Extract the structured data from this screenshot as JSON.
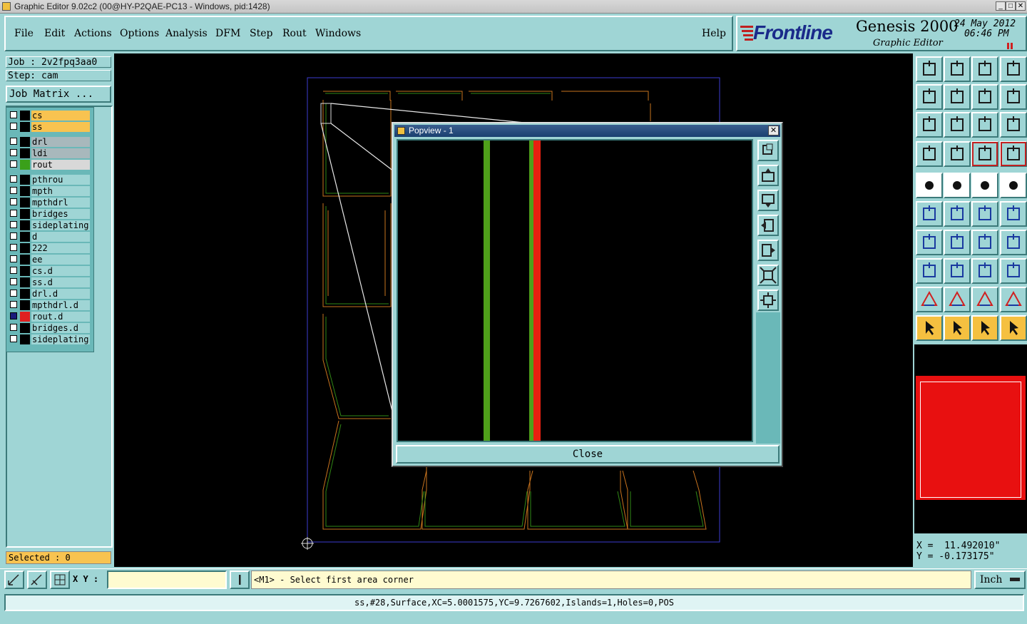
{
  "window": {
    "title": "Graphic Editor 9.02c2 (00@HY-P2QAE-PC13 - Windows, pid:1428)"
  },
  "menu": [
    "File",
    "Edit",
    "Actions",
    "Options",
    "Analysis",
    "DFM",
    "Step",
    "Rout",
    "Windows"
  ],
  "help_label": "Help",
  "brand": {
    "logo": "Frontline",
    "product": "Genesis 2000",
    "module": "Graphic Editor",
    "date": "24 May 2012",
    "time": "06:46 PM"
  },
  "job": {
    "job_label": "Job : 2v2fpq3aa0",
    "step_label": "Step: cam",
    "matrix_button": "Job Matrix ..."
  },
  "layers": [
    {
      "name": "cs",
      "color": "#000000",
      "checked": false,
      "highlight": "#f8c350"
    },
    {
      "name": "ss",
      "color": "#000000",
      "checked": false,
      "highlight": "#f8c350"
    },
    {
      "name": "drl",
      "color": "#000000",
      "checked": false,
      "highlight": "#a8b8bc"
    },
    {
      "name": "ldi",
      "color": "#000000",
      "checked": false,
      "highlight": "#a8b8bc"
    },
    {
      "name": "rout",
      "color": "#3aa01a",
      "checked": false,
      "highlight": "#d8d8d8"
    },
    {
      "name": "pthrou",
      "color": "#000000",
      "checked": false,
      "highlight": ""
    },
    {
      "name": "mpth",
      "color": "#000000",
      "checked": false,
      "highlight": ""
    },
    {
      "name": "mpthdrl",
      "color": "#000000",
      "checked": false,
      "highlight": ""
    },
    {
      "name": "bridges",
      "color": "#000000",
      "checked": false,
      "highlight": ""
    },
    {
      "name": "sideplating",
      "color": "#000000",
      "checked": false,
      "highlight": ""
    },
    {
      "name": "d",
      "color": "#000000",
      "checked": false,
      "highlight": ""
    },
    {
      "name": "222",
      "color": "#000000",
      "checked": false,
      "highlight": ""
    },
    {
      "name": "ee",
      "color": "#000000",
      "checked": false,
      "highlight": ""
    },
    {
      "name": "cs.d",
      "color": "#000000",
      "checked": false,
      "highlight": ""
    },
    {
      "name": "ss.d",
      "color": "#000000",
      "checked": false,
      "highlight": ""
    },
    {
      "name": "drl.d",
      "color": "#000000",
      "checked": false,
      "highlight": ""
    },
    {
      "name": "mpthdrl.d",
      "color": "#000000",
      "checked": false,
      "highlight": ""
    },
    {
      "name": "rout.d",
      "color": "#e02020",
      "checked": true,
      "highlight": ""
    },
    {
      "name": "bridges.d",
      "color": "#000000",
      "checked": false,
      "highlight": ""
    },
    {
      "name": "sideplating",
      "color": "#000000",
      "checked": false,
      "highlight": ""
    }
  ],
  "selected_label": "Selected : 0",
  "popup": {
    "title": "Popview - 1",
    "close_label": "Close"
  },
  "coords": {
    "x": "X =  11.492010\"",
    "y": "Y = -0.173175\""
  },
  "xy_label": "X Y :",
  "prompt": "<M1> - Select first area corner",
  "units": "Inch",
  "status": "ss,#28,Surface,XC=5.0001575,YC=9.7267602,Islands=1,Holes=0,POS",
  "colors": {
    "accent": "#9fd5d5",
    "highlight": "#f8c350",
    "rout_green": "#3aa01a",
    "rout_red": "#e02020"
  }
}
